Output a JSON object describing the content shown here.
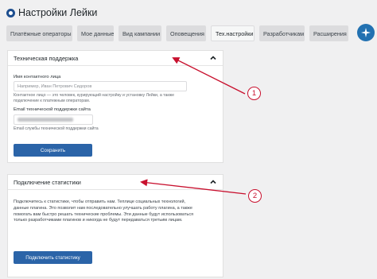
{
  "header": {
    "title": "Настройки Лейки"
  },
  "tabs": [
    {
      "label": "Платёжные операторы"
    },
    {
      "label": "Мое данные"
    },
    {
      "label": "Вид кампании"
    },
    {
      "label": "Оповещения"
    },
    {
      "label": "Тех.настройки"
    },
    {
      "label": "Разработчикам"
    },
    {
      "label": "Расширения"
    }
  ],
  "support_card": {
    "title": "Техническая поддержка",
    "contact_label": "Имя контактного лица",
    "contact_placeholder": "Например, Иван Петрович Сидоров",
    "contact_desc": "Контактное лицо — это человек, курирующий настройку и установку Лейки, а также подключение к платежным операторам.",
    "email_label": "Email технической поддержки сайта",
    "email_desc": "Email службы технической поддержки сайта",
    "save_button": "Сохранить"
  },
  "stats_card": {
    "title": "Подключение статистики",
    "text": "Подключитесь к статистике, чтобы отправить нам. Теплице социальных технологий, данные плагина. Это позволит нам последовательно улучшать работу плагина, а также помогать вам быстро решать технические проблемы. Эти данные будут использоваться только разработчиками плагинов и никогда не будут передаваться третьим лицам.",
    "connect_button": "Подключить статистику"
  },
  "annotations": {
    "one": "1",
    "two": "2"
  },
  "colors": {
    "annotation": "#c8102e",
    "primary_button": "#2b64a8",
    "accent": "#2271b1"
  }
}
